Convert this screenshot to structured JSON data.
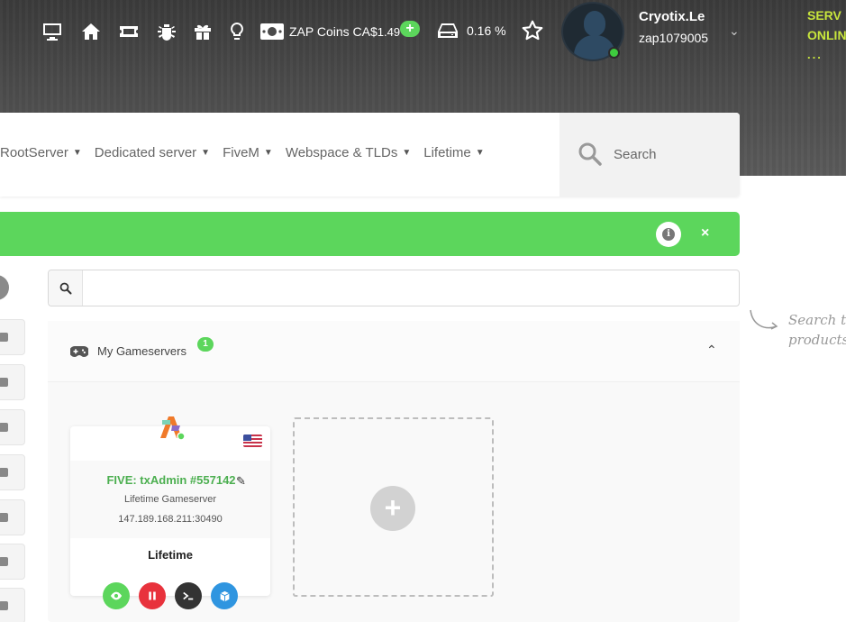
{
  "topbar": {
    "coins_label": "ZAP Coins CA$",
    "coins_value": "1.49",
    "add_label": "+",
    "storage_value": "0.16 %",
    "user_name": "Cryotix.Le",
    "user_id": "zap1079005",
    "server_status_line1": "SERV",
    "server_status_line2": "ONLIN",
    "server_status_dots": "...",
    "icons": [
      "monitor-icon",
      "home-icon",
      "ticket-icon",
      "bug-icon",
      "gift-icon",
      "lightbulb-icon",
      "money-icon",
      "storage-icon",
      "star-icon"
    ]
  },
  "nav": {
    "items": [
      {
        "label": "RootServer"
      },
      {
        "label": "Dedicated server"
      },
      {
        "label": "FiveM"
      },
      {
        "label": "Webspace & TLDs"
      },
      {
        "label": "Lifetime"
      }
    ],
    "search_label": "Search"
  },
  "notice": {
    "close_label": "×",
    "color": "#5cd65c"
  },
  "search": {
    "placeholder": ""
  },
  "hint": {
    "text": "Search t products"
  },
  "gameservers": {
    "title": "My Gameservers",
    "count": "1",
    "servers": [
      {
        "name": "FIVE: txAdmin #557142",
        "type": "Lifetime Gameserver",
        "ip": "147.189.168.211:30490",
        "plan": "Lifetime"
      }
    ]
  },
  "colors": {
    "accent_green": "#5cd65c",
    "danger": "#e8323c",
    "info": "#2f95e0",
    "status_yellow": "#c8e63c"
  }
}
